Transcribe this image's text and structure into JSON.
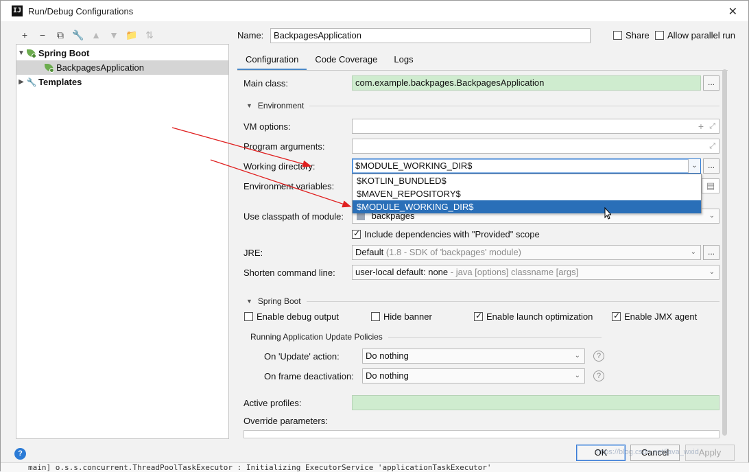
{
  "window": {
    "title": "Run/Debug Configurations",
    "close_glyph": "✕"
  },
  "toolbar": [
    "+",
    "−",
    "⧉",
    "🔧",
    "▲",
    "▼",
    "📁",
    "⇅"
  ],
  "tree": {
    "group": "Spring Boot",
    "item": "BackpagesApplication",
    "templates": "Templates"
  },
  "header": {
    "name_label": "Name:",
    "name_value": "BackpagesApplication",
    "share": "Share",
    "allow_parallel": "Allow parallel run"
  },
  "tabs": [
    "Configuration",
    "Code Coverage",
    "Logs"
  ],
  "form": {
    "main_class_label": "Main class:",
    "main_class_value": "com.example.backpages.BackpagesApplication",
    "environment": "Environment",
    "vm_options_label": "VM options:",
    "program_args_label": "Program arguments:",
    "working_dir_label": "Working directory:",
    "working_dir_value": "$MODULE_WORKING_DIR$",
    "env_vars_label": "Environment variables:",
    "classpath_label": "Use classpath of module:",
    "classpath_value": "backpages",
    "include_deps": "Include dependencies with \"Provided\" scope",
    "jre_label": "JRE:",
    "jre_value": "Default",
    "jre_detail": "(1.8 - SDK of 'backpages' module)",
    "shorten_label": "Shorten command line:",
    "shorten_value": "user-local default: none",
    "shorten_detail": "- java [options] classname [args]",
    "spring_boot": "Spring Boot",
    "debug_output": "Enable debug output",
    "hide_banner": "Hide banner",
    "launch_opt": "Enable launch optimization",
    "jmx_agent": "Enable JMX agent",
    "update_policies": "Running Application Update Policies",
    "on_update_label": "On 'Update' action:",
    "on_update_value": "Do nothing",
    "on_frame_label": "On frame deactivation:",
    "on_frame_value": "Do nothing",
    "active_profiles_label": "Active profiles:",
    "override_label": "Override parameters:",
    "dots": "..."
  },
  "popup": [
    "$KOTLIN_BUNDLED$",
    "$MAVEN_REPOSITORY$",
    "$MODULE_WORKING_DIR$"
  ],
  "buttons": {
    "ok": "OK",
    "cancel": "Cancel",
    "apply": "Apply",
    "help": "?"
  },
  "bottom_log": "main] o.s.s.concurrent.ThreadPoolTaskExecutor  : Initializing ExecutorService 'applicationTaskExecutor'",
  "watermark": "https://blog.csdn.net/java_wxid",
  "colors": {
    "accent": "#2a6fb8",
    "green_field": "#cfeccf",
    "arrow": "#e02020"
  }
}
